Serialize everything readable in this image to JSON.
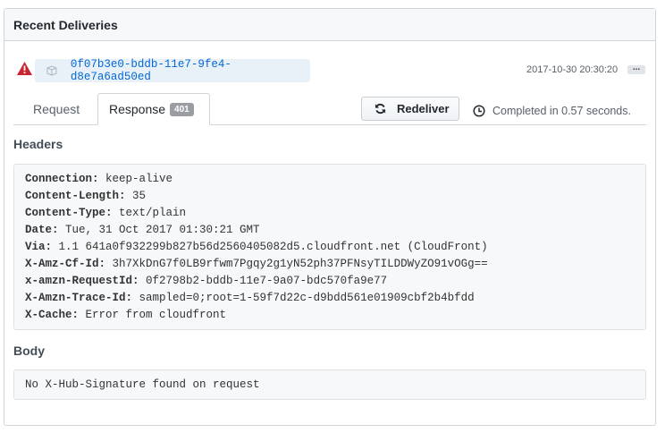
{
  "title": "Recent Deliveries",
  "delivery": {
    "guid": "0f07b3e0-bddb-11e7-9fe4-d8e7a6ad50ed",
    "timestamp": "2017-10-30 20:30:20",
    "more": "...",
    "status": "error"
  },
  "tabs": [
    {
      "label": "Request"
    },
    {
      "label": "Response",
      "count": "401"
    }
  ],
  "redeliver_label": "Redeliver",
  "completed": "Completed in 0.57 seconds.",
  "headers_label": "Headers",
  "headers": [
    {
      "k": "Connection:",
      "v": " keep-alive"
    },
    {
      "k": "Content-Length:",
      "v": " 35"
    },
    {
      "k": "Content-Type:",
      "v": " text/plain"
    },
    {
      "k": "Date:",
      "v": " Tue, 31 Oct 2017 01:30:21 GMT"
    },
    {
      "k": "Via:",
      "v": " 1.1 641a0f932299b827b56d2560405082d5.cloudfront.net (CloudFront)"
    },
    {
      "k": "X-Amz-Cf-Id:",
      "v": " 3h7XkDnG7f0LB9rfwm7Pgqy2g1yN52ph37PFNsyTILDDWyZO91vOGg=="
    },
    {
      "k": "x-amzn-RequestId:",
      "v": " 0f2798b2-bddb-11e7-9a07-bdc570fa9e77"
    },
    {
      "k": "X-Amzn-Trace-Id:",
      "v": " sampled=0;root=1-59f7d22c-d9bdd561e01909cbf2b4bfdd"
    },
    {
      "k": "X-Cache:",
      "v": " Error from cloudfront"
    }
  ],
  "body_label": "Body",
  "body": "No X-Hub-Signature found on request"
}
